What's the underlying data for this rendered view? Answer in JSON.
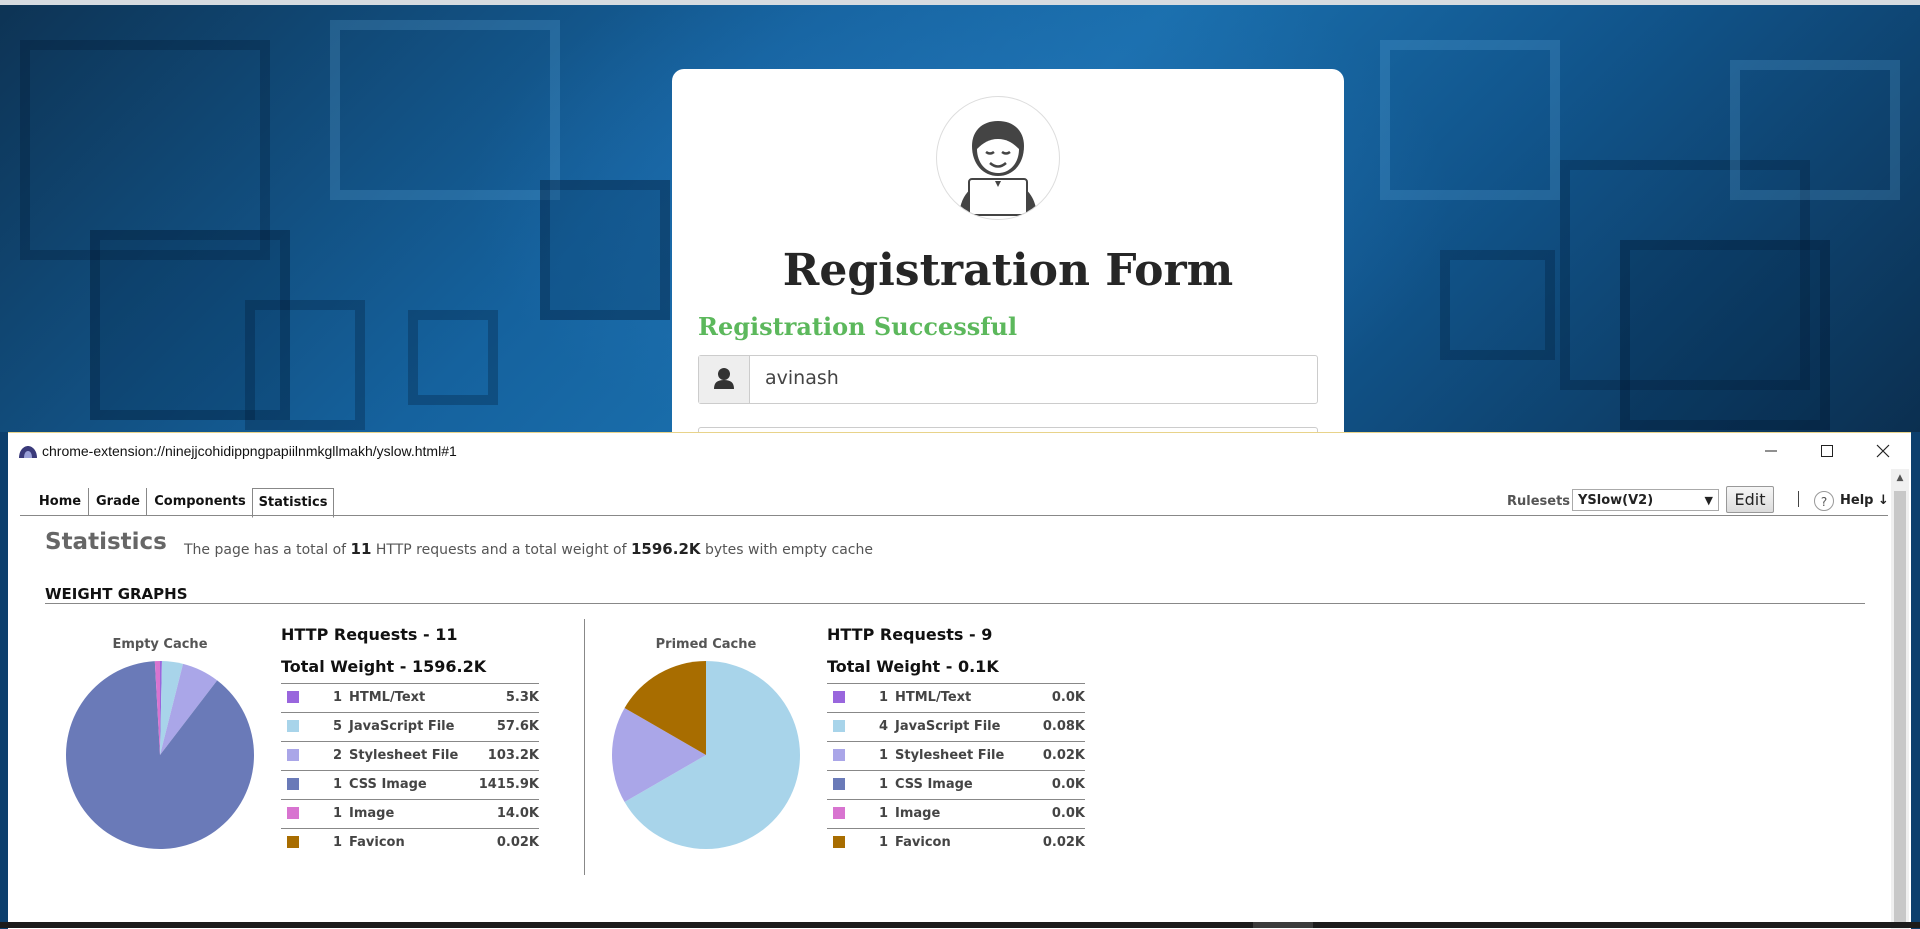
{
  "registration": {
    "title": "Registration Form",
    "success_message": "Registration Successful",
    "username_value": "avinash"
  },
  "window": {
    "url": "chrome-extension://ninejjcohidippngpapiilnmkgllmakh/yslow.html#1"
  },
  "nav": {
    "tabs": [
      {
        "label": "Home"
      },
      {
        "label": "Grade"
      },
      {
        "label": "Components"
      },
      {
        "label": "Statistics"
      }
    ],
    "rulesets_label": "Rulesets",
    "ruleset_selected": "YSlow(V2)",
    "edit_label": "Edit",
    "help_label": "Help ↓",
    "help_icon": "?"
  },
  "stats": {
    "title": "Statistics",
    "summary_pre": "The page has a total of",
    "summary_requests": "11",
    "summary_mid": "HTTP requests and a total weight of",
    "summary_weight": "1596.2K",
    "summary_post": "bytes with empty cache"
  },
  "weight_graphs": {
    "heading": "WEIGHT GRAPHS",
    "empty": {
      "caption": "Empty Cache",
      "requests": "HTTP Requests - 11",
      "weight": "Total Weight - 1596.2K",
      "rows": [
        {
          "count": "1",
          "type": "HTML/Text",
          "size": "5.3K",
          "color": "#9966dd"
        },
        {
          "count": "5",
          "type": "JavaScript File",
          "size": "57.6K",
          "color": "#a8d4ea"
        },
        {
          "count": "2",
          "type": "Stylesheet File",
          "size": "103.2K",
          "color": "#aaa6e8"
        },
        {
          "count": "1",
          "type": "CSS Image",
          "size": "1415.9K",
          "color": "#6a7ab8"
        },
        {
          "count": "1",
          "type": "Image",
          "size": "14.0K",
          "color": "#d874d0"
        },
        {
          "count": "1",
          "type": "Favicon",
          "size": "0.02K",
          "color": "#a86d00"
        }
      ]
    },
    "primed": {
      "caption": "Primed Cache",
      "requests": "HTTP Requests - 9",
      "weight": "Total Weight - 0.1K",
      "rows": [
        {
          "count": "1",
          "type": "HTML/Text",
          "size": "0.0K",
          "color": "#9966dd"
        },
        {
          "count": "4",
          "type": "JavaScript File",
          "size": "0.08K",
          "color": "#a8d4ea"
        },
        {
          "count": "1",
          "type": "Stylesheet File",
          "size": "0.02K",
          "color": "#aaa6e8"
        },
        {
          "count": "1",
          "type": "CSS Image",
          "size": "0.0K",
          "color": "#6a7ab8"
        },
        {
          "count": "1",
          "type": "Image",
          "size": "0.0K",
          "color": "#d874d0"
        },
        {
          "count": "1",
          "type": "Favicon",
          "size": "0.02K",
          "color": "#a86d00"
        }
      ]
    }
  },
  "chart_data": [
    {
      "type": "pie",
      "title": "Empty Cache",
      "categories": [
        "HTML/Text",
        "JavaScript File",
        "Stylesheet File",
        "CSS Image",
        "Image",
        "Favicon"
      ],
      "values": [
        5.3,
        57.6,
        103.2,
        1415.9,
        14.0,
        0.02
      ],
      "colors": [
        "#9966dd",
        "#a8d4ea",
        "#aaa6e8",
        "#6a7ab8",
        "#d874d0",
        "#a86d00"
      ]
    },
    {
      "type": "pie",
      "title": "Primed Cache",
      "categories": [
        "HTML/Text",
        "JavaScript File",
        "Stylesheet File",
        "CSS Image",
        "Image",
        "Favicon"
      ],
      "values": [
        0.0,
        0.08,
        0.02,
        0.0,
        0.0,
        0.02
      ],
      "colors": [
        "#9966dd",
        "#a8d4ea",
        "#aaa6e8",
        "#6a7ab8",
        "#d874d0",
        "#a86d00"
      ]
    }
  ]
}
